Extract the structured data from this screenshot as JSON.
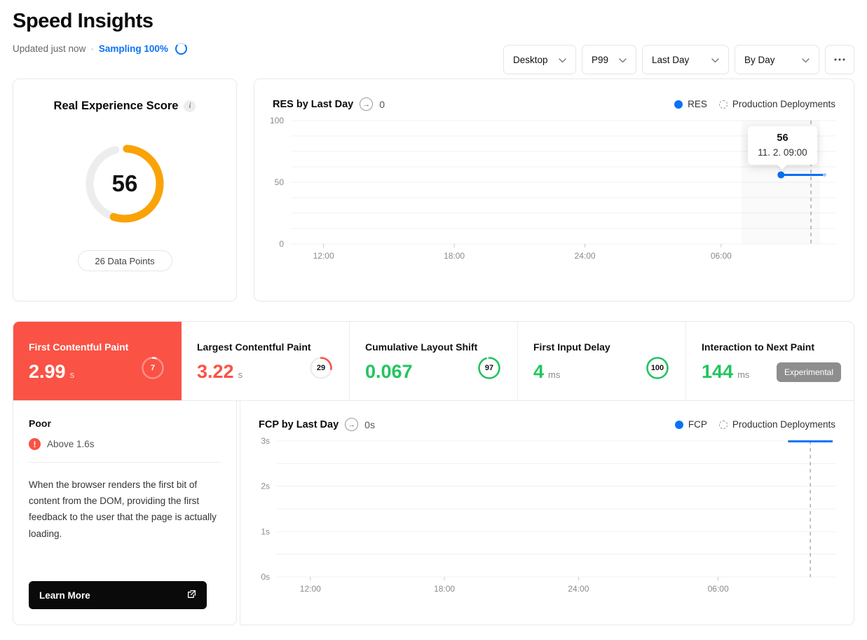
{
  "header": {
    "title": "Speed Insights",
    "updated": "Updated just now",
    "separator": "·",
    "sampling": "Sampling 100%"
  },
  "filters": [
    {
      "label": "Desktop",
      "name": "device-filter"
    },
    {
      "label": "P99",
      "name": "percentile-filter"
    },
    {
      "label": "Last Day",
      "name": "period-filter"
    },
    {
      "label": "By Day",
      "name": "granularity-filter"
    }
  ],
  "more_label": "•••",
  "res_card": {
    "title": "Real Experience Score",
    "info_glyph": "i",
    "score": "56",
    "score_value": 56,
    "data_points": "26 Data Points",
    "arc_color": "#FAA307",
    "track_color": "#ededed"
  },
  "res_chart": {
    "title": "RES by Last Day",
    "arrow_glyph": "→",
    "metric": "0",
    "legend": [
      {
        "label": "RES",
        "type": "solid",
        "color": "#0a72f5"
      },
      {
        "label": "Production Deployments",
        "type": "dashed",
        "color": "#999999"
      }
    ],
    "tooltip": {
      "value": "56",
      "time": "11. 2. 09:00"
    }
  },
  "metrics": [
    {
      "name": "First Contentful Paint",
      "value": "2.99",
      "unit": "s",
      "score": "7",
      "score_value": 7,
      "color": "#ffffff",
      "ring_color": "#ffffff",
      "selected": true,
      "badge": null
    },
    {
      "name": "Largest Contentful Paint",
      "value": "3.22",
      "unit": "s",
      "score": "29",
      "score_value": 29,
      "color": "#FA5245",
      "ring_color": "#FA5245",
      "selected": false,
      "badge": null
    },
    {
      "name": "Cumulative Layout Shift",
      "value": "0.067",
      "unit": "",
      "score": "97",
      "score_value": 97,
      "color": "#22c55e",
      "ring_color": "#22c55e",
      "selected": false,
      "badge": null
    },
    {
      "name": "First Input Delay",
      "value": "4",
      "unit": "ms",
      "score": "100",
      "score_value": 100,
      "color": "#22c55e",
      "ring_color": "#22c55e",
      "selected": false,
      "badge": null
    },
    {
      "name": "Interaction to Next Paint",
      "value": "144",
      "unit": "ms",
      "score": null,
      "score_value": null,
      "color": "#22c55e",
      "ring_color": null,
      "selected": false,
      "badge": "Experimental"
    }
  ],
  "detail": {
    "status": "Poor",
    "alert_glyph": "!",
    "threshold": "Above 1.6s",
    "description": "When the browser renders the first bit of content from the DOM, providing the first feedback to the user that the page is actually loading.",
    "learn_more": "Learn More",
    "external_glyph": "↗"
  },
  "fcp_chart": {
    "title": "FCP by Last Day",
    "arrow_glyph": "→",
    "metric": "0s",
    "legend": [
      {
        "label": "FCP",
        "type": "solid",
        "color": "#0a72f5"
      },
      {
        "label": "Production Deployments",
        "type": "dashed",
        "color": "#999999"
      }
    ]
  },
  "chart_data": [
    {
      "id": "res",
      "type": "line",
      "title": "RES by Last Day",
      "xlabel": "",
      "ylabel": "",
      "ylim": [
        0,
        100
      ],
      "yticks": [
        0,
        50,
        100
      ],
      "ytick_labels": [
        "0",
        "50",
        "100"
      ],
      "gridlines": [
        0,
        12.5,
        25,
        37.5,
        50,
        62.5,
        75,
        87.5,
        100
      ],
      "xticks": [
        "12:00",
        "18:00",
        "24:00",
        "06:00"
      ],
      "xtick_positions": [
        0.06,
        0.3,
        0.54,
        0.79
      ],
      "series": [
        {
          "name": "RES",
          "color": "#0a72f5",
          "points": [
            {
              "x": 0.9,
              "y": 56
            },
            {
              "x": 0.98,
              "y": 56
            }
          ]
        }
      ],
      "markers": [
        {
          "name": "Production Deployments",
          "x": 0.955,
          "style": "dashed"
        }
      ],
      "legend_position": "top-right",
      "grid": true
    },
    {
      "id": "fcp",
      "type": "line",
      "title": "FCP by Last Day",
      "xlabel": "",
      "ylabel": "",
      "ylim": [
        0,
        3
      ],
      "yticks": [
        0,
        1,
        2,
        3
      ],
      "ytick_labels": [
        "0s",
        "1s",
        "2s",
        "3s"
      ],
      "gridlines": [
        0,
        0.5,
        1,
        1.5,
        2,
        2.5,
        3
      ],
      "xticks": [
        "12:00",
        "18:00",
        "24:00",
        "06:00"
      ],
      "xtick_positions": [
        0.06,
        0.3,
        0.54,
        0.79
      ],
      "series": [
        {
          "name": "FCP",
          "color": "#0a72f5",
          "points": [
            {
              "x": 0.915,
              "y": 2.99
            },
            {
              "x": 0.995,
              "y": 2.99
            }
          ]
        }
      ],
      "markers": [
        {
          "name": "Production Deployments",
          "x": 0.955,
          "style": "dashed"
        }
      ],
      "legend_position": "top-right",
      "grid": true
    }
  ]
}
